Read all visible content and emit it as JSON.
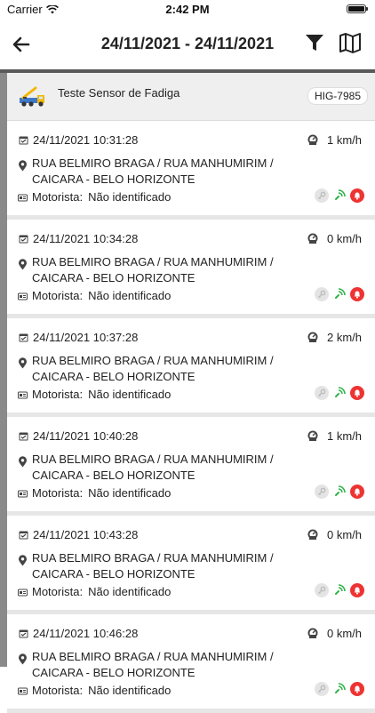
{
  "status_bar": {
    "carrier": "Carrier",
    "time": "2:42 PM"
  },
  "nav": {
    "title": "24/11/2021 - 24/11/2021"
  },
  "vehicle": {
    "name": "Teste Sensor de Fadiga",
    "plate": "HIG-7985"
  },
  "driver_label": "Motorista:",
  "events": [
    {
      "datetime": "24/11/2021 10:31:28",
      "speed": "1 km/h",
      "address": "RUA BELMIRO BRAGA / RUA MANHUMIRIM / CAICARA - BELO HORIZONTE",
      "driver": "Não identificado"
    },
    {
      "datetime": "24/11/2021 10:34:28",
      "speed": "0 km/h",
      "address": "RUA BELMIRO BRAGA / RUA MANHUMIRIM / CAICARA - BELO HORIZONTE",
      "driver": "Não identificado"
    },
    {
      "datetime": "24/11/2021 10:37:28",
      "speed": "2 km/h",
      "address": "RUA BELMIRO BRAGA / RUA MANHUMIRIM / CAICARA - BELO HORIZONTE",
      "driver": "Não identificado"
    },
    {
      "datetime": "24/11/2021 10:40:28",
      "speed": "1 km/h",
      "address": "RUA BELMIRO BRAGA / RUA MANHUMIRIM / CAICARA - BELO HORIZONTE",
      "driver": "Não identificado"
    },
    {
      "datetime": "24/11/2021 10:43:28",
      "speed": "0 km/h",
      "address": "RUA BELMIRO BRAGA / RUA MANHUMIRIM / CAICARA - BELO HORIZONTE",
      "driver": "Não identificado"
    },
    {
      "datetime": "24/11/2021 10:46:28",
      "speed": "0 km/h",
      "address": "RUA BELMIRO BRAGA / RUA MANHUMIRIM / CAICARA - BELO HORIZONTE",
      "driver": "Não identificado"
    }
  ],
  "icons": {
    "back": "arrow-left-icon",
    "filter": "filter-icon",
    "map": "map-icon",
    "calendar": "calendar-icon",
    "speed": "speedometer-icon",
    "location": "location-pin-icon",
    "driver": "id-card-icon",
    "key": "key-icon",
    "ignition": "ignition-signal-icon",
    "alarm": "alarm-bell-icon"
  },
  "colors": {
    "alarm_red": "#e33333",
    "ignition_green": "#2fb44a",
    "key_gray": "#bcbcbc"
  }
}
